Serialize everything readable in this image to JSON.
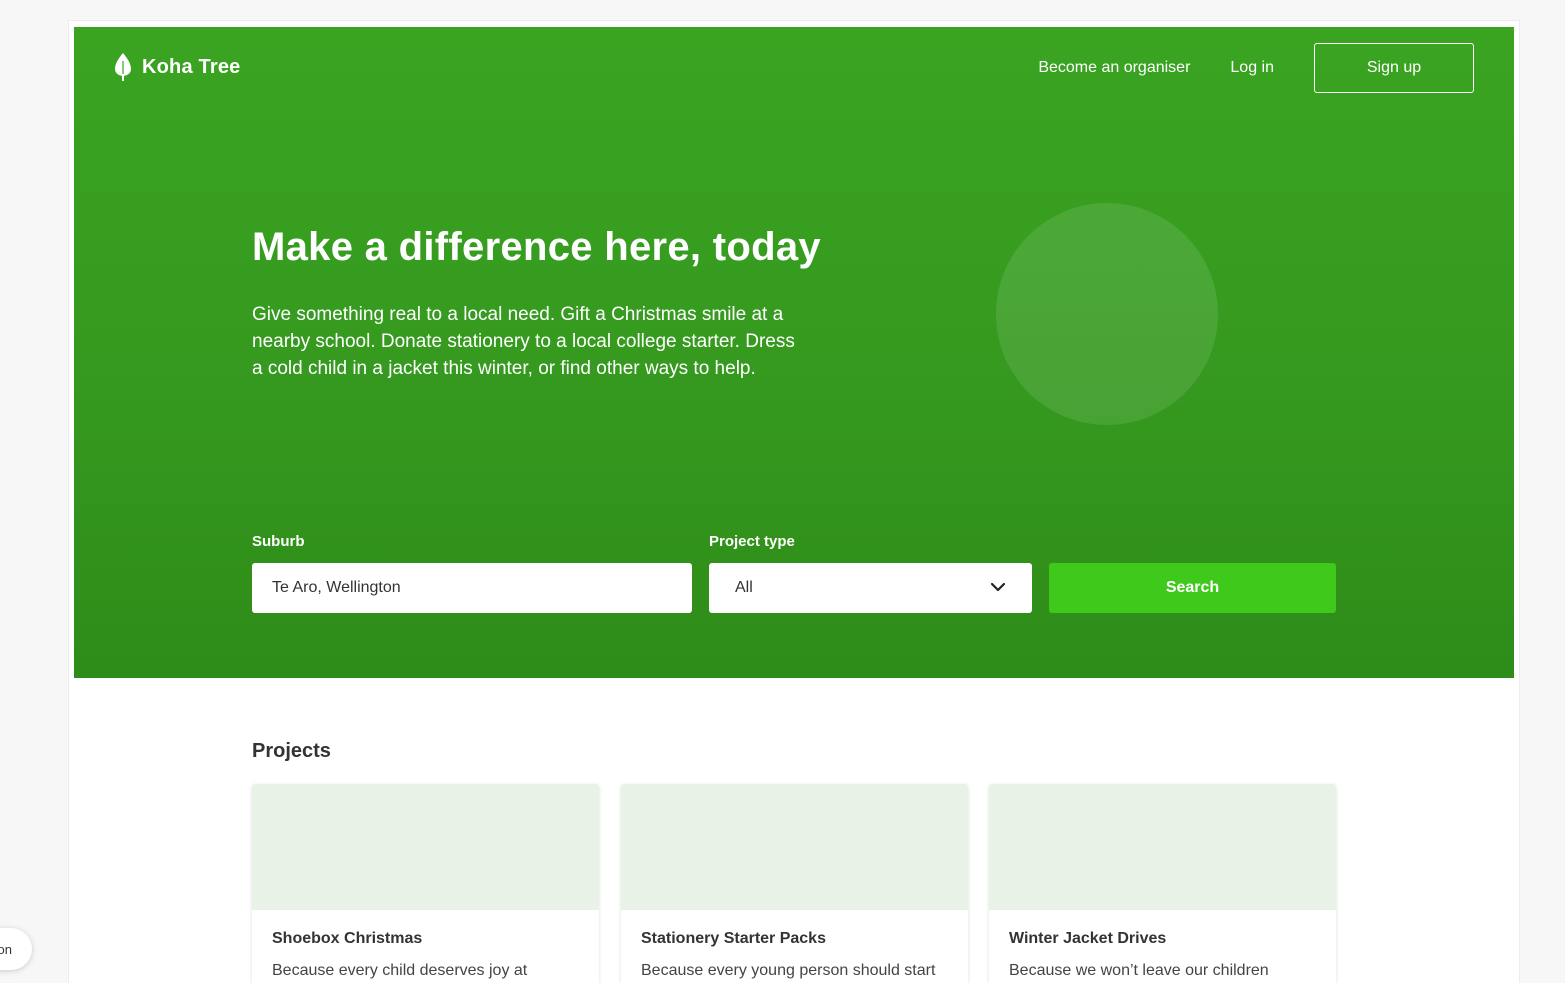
{
  "brand": {
    "name": "Koha Tree",
    "icon": "leaf-icon"
  },
  "nav": {
    "become_organiser": "Become an organiser",
    "login": "Log in",
    "signup": "Sign up"
  },
  "hero": {
    "headline": "Make a difference here, today",
    "intro": "Give something real to a local need. Gift a Christmas smile at a nearby school. Donate stationery to a local college starter. Dress a cold child in a jacket this winter, or find other ways to help."
  },
  "search": {
    "suburb_label": "Suburb",
    "suburb_value": "Te Aro, Wellington",
    "project_type_label": "Project type",
    "project_type_value": "All",
    "button": "Search"
  },
  "projects": {
    "title": "Projects",
    "items": [
      {
        "title": "Shoebox Christmas",
        "desc": "Because every child deserves joy at"
      },
      {
        "title": "Stationery Starter Packs",
        "desc": "Because every young person should start"
      },
      {
        "title": "Winter Jacket Drives",
        "desc": "Because we won’t leave our children"
      }
    ]
  },
  "side_widget": {
    "label": "on"
  },
  "colors": {
    "hero_green": "#3aa421",
    "search_button": "#3ec91b",
    "card_image": "#e9f2e7"
  }
}
